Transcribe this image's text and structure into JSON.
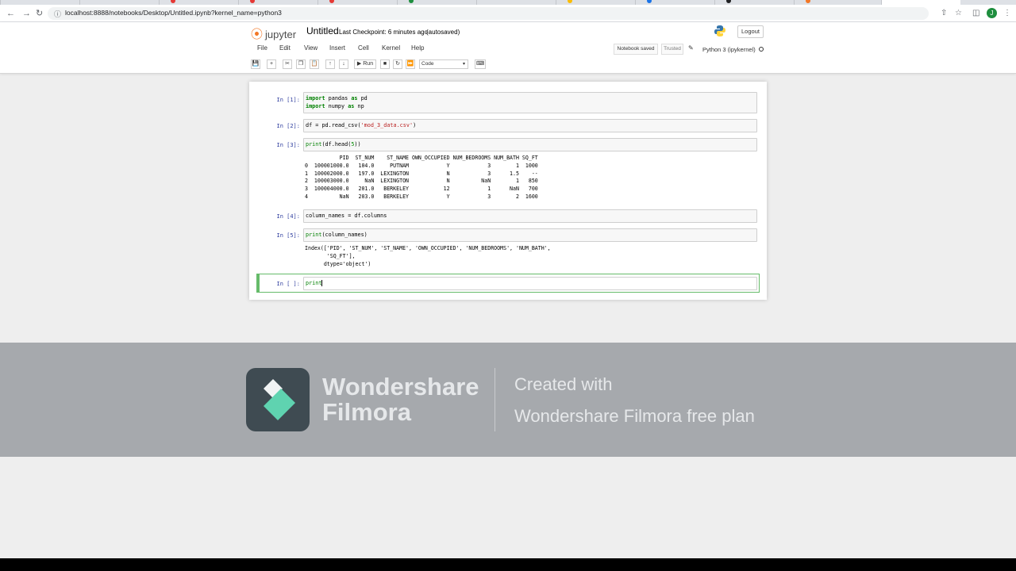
{
  "browser": {
    "url": "localhost:8888/notebooks/Desktop/Untitled.ipynb?kernel_name=python3",
    "profile_initial": "J"
  },
  "jupyter": {
    "logo_text": "jupyter",
    "notebook_name": "Untitled",
    "checkpoint": "Last Checkpoint: 6 minutes ago",
    "autosaved": "(autosaved)",
    "logout": "Logout",
    "menu": [
      "File",
      "Edit",
      "View",
      "Insert",
      "Cell",
      "Kernel",
      "Help"
    ],
    "notebook_saved": "Notebook saved",
    "trusted": "Trusted",
    "kernel": "Python 3 (ipykernel)",
    "run_label": "Run",
    "cell_type": "Code"
  },
  "cells": [
    {
      "prompt": "In [1]:",
      "code": "import pandas as pd\nimport numpy as np"
    },
    {
      "prompt": "In [2]:",
      "code": "df = pd.read_csv('mod_3_data.csv')"
    },
    {
      "prompt": "In [3]:",
      "code": "print(df.head(5))",
      "output": "           PID  ST_NUM    ST_NAME OWN_OCCUPIED NUM_BEDROOMS NUM_BATH SQ_FT\n0  100001000.0   104.0     PUTNAM            Y            3        1  1000\n1  100002000.0   197.0  LEXINGTON            N            3      1.5    --\n2  100003000.0     NaN  LEXINGTON            N          NaN        1   850\n3  100004000.0   201.0   BERKELEY           12            1      NaN   700\n4          NaN   203.0   BERKELEY            Y            3        2  1600"
    },
    {
      "prompt": "In [4]:",
      "code": "column_names = df.columns"
    },
    {
      "prompt": "In [5]:",
      "code": "print(column_names)",
      "output": "Index(['PID', 'ST_NUM', 'ST_NAME', 'OWN_OCCUPIED', 'NUM_BEDROOMS', 'NUM_BATH',\n       'SQ_FT'],\n      dtype='object')"
    },
    {
      "prompt": "In [ ]:",
      "code": "print"
    }
  ],
  "watermark": {
    "brand_line1": "Wondershare",
    "brand_line2": "Filmora",
    "created": "Created with",
    "plan": "Wondershare Filmora free plan"
  },
  "colors": {
    "jupyter_orange": "#f37726",
    "prompt_blue": "#303f9f",
    "selected_cell_green": "#66bb6a",
    "filmora_teal": "#5fd3b0"
  }
}
